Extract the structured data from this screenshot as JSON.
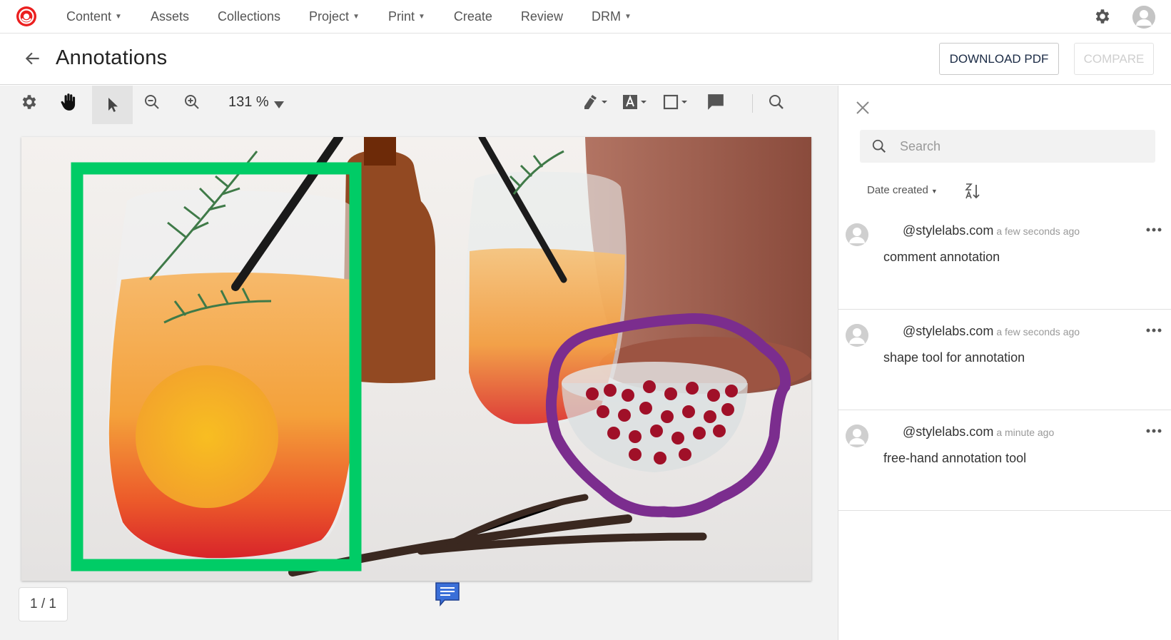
{
  "topnav": {
    "logo_icon": "sitecore-logo",
    "items": [
      {
        "label": "Content",
        "has_caret": true
      },
      {
        "label": "Assets",
        "has_caret": false
      },
      {
        "label": "Collections",
        "has_caret": false
      },
      {
        "label": "Project",
        "has_caret": true
      },
      {
        "label": "Print",
        "has_caret": true
      },
      {
        "label": "Create",
        "has_caret": false
      },
      {
        "label": "Review",
        "has_caret": false
      },
      {
        "label": "DRM",
        "has_caret": true
      }
    ],
    "settings_icon": "gear-icon",
    "avatar_icon": "user-avatar-icon"
  },
  "header": {
    "back_icon": "arrow-left-icon",
    "title": "Annotations",
    "download_label": "DOWNLOAD PDF",
    "compare_label": "COMPARE"
  },
  "toolbar": {
    "zoom_value": "131 %",
    "active_tool": "select",
    "tools_left": [
      "gear-icon",
      "hand-pan-icon",
      "pointer-select-icon",
      "zoom-out-icon",
      "zoom-in-icon"
    ],
    "tools_right": [
      "highlighter-icon",
      "text-annotation-icon",
      "rectangle-shape-icon",
      "comment-icon",
      "search-icon"
    ]
  },
  "document": {
    "page_counter": "1 / 1",
    "annotation_colors": {
      "rectangle": "#00cc66",
      "freehand": "#7b2d8e",
      "comment_marker": "#3a6fd8"
    }
  },
  "panel": {
    "close_icon": "close-icon",
    "search_placeholder": "Search",
    "sort_label": "Date created",
    "sort_order_icon": "sort-z-a-icon",
    "comments": [
      {
        "user": "@stylelabs.com",
        "time": "a few seconds ago",
        "text": "comment annotation"
      },
      {
        "user": "@stylelabs.com",
        "time": "a few seconds ago",
        "text": "shape tool for annotation"
      },
      {
        "user": "@stylelabs.com",
        "time": "a minute ago",
        "text": "free-hand annotation tool"
      }
    ]
  }
}
